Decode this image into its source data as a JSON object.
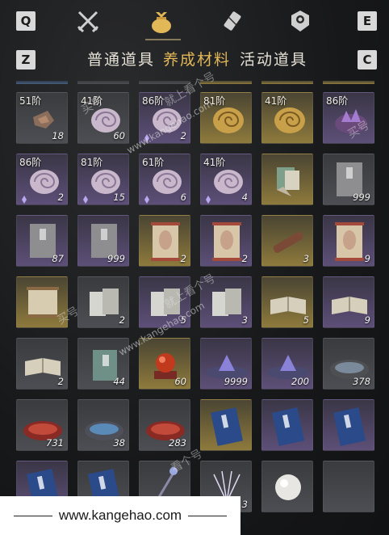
{
  "keys": {
    "q": "Q",
    "e": "E",
    "z": "Z",
    "c": "C"
  },
  "icon_tabs": [
    {
      "name": "swords-icon"
    },
    {
      "name": "pouch-icon",
      "active": true
    },
    {
      "name": "scroll-icon"
    },
    {
      "name": "badge-icon"
    }
  ],
  "subtabs": [
    {
      "label": "普通道具",
      "active": false
    },
    {
      "label": "养成材料",
      "active": true
    },
    {
      "label": "活动道具",
      "active": false
    }
  ],
  "accent_color": "#e2b758",
  "items": [
    {
      "tier": "51阶",
      "count": "18",
      "rarity": "gray",
      "icon": "rock-shard-icon"
    },
    {
      "tier": "41阶",
      "count": "60",
      "rarity": "gray",
      "icon": "conch-shell-icon"
    },
    {
      "tier": "86阶",
      "count": "2",
      "rarity": "purple",
      "icon": "conch-shell-icon",
      "buff": true
    },
    {
      "tier": "81阶",
      "count": "",
      "rarity": "gold",
      "icon": "golden-shell-icon"
    },
    {
      "tier": "41阶",
      "count": "",
      "rarity": "gold",
      "icon": "golden-shell-icon"
    },
    {
      "tier": "86阶",
      "count": "",
      "rarity": "purple",
      "icon": "amethyst-icon"
    },
    {
      "tier": "86阶",
      "count": "2",
      "rarity": "purple",
      "icon": "conch-shell-icon",
      "buff": true
    },
    {
      "tier": "81阶",
      "count": "15",
      "rarity": "purple",
      "icon": "conch-shell-icon",
      "buff": true
    },
    {
      "tier": "61阶",
      "count": "6",
      "rarity": "purple",
      "icon": "conch-shell-icon",
      "buff": true
    },
    {
      "tier": "41阶",
      "count": "4",
      "rarity": "purple",
      "icon": "conch-shell-icon",
      "buff": true
    },
    {
      "tier": "",
      "count": "",
      "rarity": "gold",
      "icon": "fan-book-icon"
    },
    {
      "tier": "",
      "count": "999",
      "rarity": "gray",
      "icon": "gray-book-icon"
    },
    {
      "tier": "",
      "count": "87",
      "rarity": "purple",
      "icon": "gray-book-icon"
    },
    {
      "tier": "",
      "count": "999",
      "rarity": "purple",
      "icon": "gray-book-icon"
    },
    {
      "tier": "",
      "count": "2",
      "rarity": "gold",
      "icon": "portrait-scroll-icon"
    },
    {
      "tier": "",
      "count": "2",
      "rarity": "purple",
      "icon": "portrait-scroll-icon"
    },
    {
      "tier": "",
      "count": "3",
      "rarity": "gold",
      "icon": "rolled-scroll-icon"
    },
    {
      "tier": "",
      "count": "9",
      "rarity": "purple",
      "icon": "portrait-scroll-icon"
    },
    {
      "tier": "",
      "count": "",
      "rarity": "gold",
      "icon": "parchment-icon"
    },
    {
      "tier": "",
      "count": "2",
      "rarity": "gray",
      "icon": "book-stack-icon"
    },
    {
      "tier": "",
      "count": "5",
      "rarity": "purple",
      "icon": "book-stack-icon"
    },
    {
      "tier": "",
      "count": "3",
      "rarity": "purple",
      "icon": "book-stack-icon"
    },
    {
      "tier": "",
      "count": "5",
      "rarity": "gold",
      "icon": "open-book-icon"
    },
    {
      "tier": "",
      "count": "9",
      "rarity": "purple",
      "icon": "open-book-icon"
    },
    {
      "tier": "",
      "count": "2",
      "rarity": "gray",
      "icon": "open-book-icon"
    },
    {
      "tier": "",
      "count": "44",
      "rarity": "gray",
      "icon": "green-book-icon"
    },
    {
      "tier": "",
      "count": "60",
      "rarity": "gold",
      "icon": "red-orb-icon"
    },
    {
      "tier": "",
      "count": "9999",
      "rarity": "purple",
      "icon": "purple-crystal-icon"
    },
    {
      "tier": "",
      "count": "200",
      "rarity": "purple",
      "icon": "purple-crystal-icon"
    },
    {
      "tier": "",
      "count": "378",
      "rarity": "gray",
      "icon": "stone-dish-icon"
    },
    {
      "tier": "",
      "count": "731",
      "rarity": "gray",
      "icon": "red-dish-icon"
    },
    {
      "tier": "",
      "count": "38",
      "rarity": "gray",
      "icon": "blue-dish-icon"
    },
    {
      "tier": "",
      "count": "283",
      "rarity": "gray",
      "icon": "red-dish-icon"
    },
    {
      "tier": "",
      "count": "",
      "rarity": "gold",
      "icon": "blue-manual-icon"
    },
    {
      "tier": "",
      "count": "",
      "rarity": "purple",
      "icon": "blue-manual-icon"
    },
    {
      "tier": "",
      "count": "",
      "rarity": "purple",
      "icon": "blue-manual-icon"
    },
    {
      "tier": "",
      "count": "",
      "rarity": "purple",
      "icon": "blue-manual-icon"
    },
    {
      "tier": "",
      "count": "",
      "rarity": "gray",
      "icon": "blue-manual-icon"
    },
    {
      "tier": "",
      "count": "",
      "rarity": "gray",
      "icon": "feather-wand-icon"
    },
    {
      "tier": "",
      "count": "3",
      "rarity": "gray",
      "icon": "firework-icon"
    },
    {
      "tier": "",
      "count": "",
      "rarity": "gray",
      "icon": "pearl-icon"
    },
    {
      "tier": "",
      "count": "",
      "rarity": "gray",
      "icon": "empty-slot"
    }
  ],
  "watermark": {
    "cn": [
      "买号",
      "买号",
      "就上看个号",
      "买号",
      "就上看个号",
      "看个号",
      "买号"
    ],
    "url": "www.kangehao.com"
  },
  "footer": {
    "site": "www.kangehao.com"
  }
}
